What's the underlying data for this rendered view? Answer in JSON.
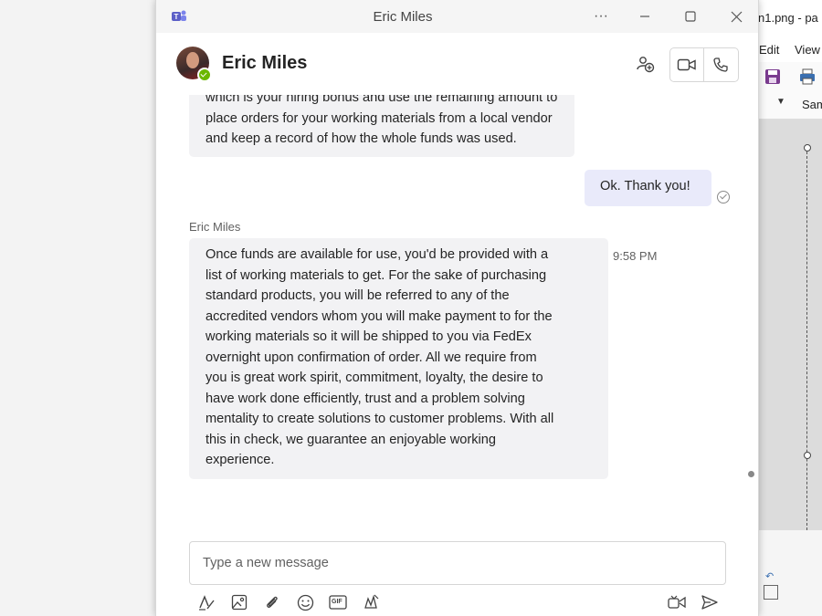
{
  "background_app": {
    "title": "n1.png - pa",
    "menu": [
      "Edit",
      "View"
    ],
    "font_box": "Sam"
  },
  "window": {
    "title": "Eric Miles",
    "controls": [
      "more-options",
      "minimize",
      "maximize",
      "close"
    ]
  },
  "header": {
    "contact_name": "Eric Miles",
    "presence": "available"
  },
  "chat": {
    "messages": [
      {
        "direction": "incoming",
        "lines": [
          "which is your hiring bonus and use the remaining amount to",
          "place orders for your working materials from a local vendor",
          "and keep a record of how the whole funds was used."
        ]
      },
      {
        "direction": "outgoing",
        "text": "Ok. Thank you!",
        "status": "seen"
      },
      {
        "direction": "incoming",
        "sender": "Eric Miles",
        "time": "9:58 PM",
        "lines": [
          "Once funds are available for use, you'd be provided with a",
          "list of working materials to get. For the sake of purchasing",
          "standard products, you will be referred to any of the",
          "accredited vendors whom you will make payment to for the",
          "working materials so it will be shipped to you via FedEx",
          "overnight upon confirmation of order. All we require from",
          "you is great work spirit, commitment, loyalty, the desire to",
          "have work done efficiently, trust and a problem solving",
          "mentality to create solutions to customer problems. With all",
          "this in check, we guarantee an enjoyable working",
          "experience."
        ]
      }
    ]
  },
  "compose": {
    "placeholder": "Type a new message"
  },
  "toolbar": {
    "tools": [
      "format-icon",
      "image-icon",
      "attach-icon",
      "emoji-icon",
      "gif-icon",
      "sticker-icon",
      "loop-icon",
      "send-icon"
    ],
    "gif_label": "GIF"
  },
  "colors": {
    "accent": "#5b5fc7",
    "incoming_bubble": "#f2f2f4",
    "outgoing_bubble": "#e9eafa",
    "presence_available": "#6bb700"
  }
}
